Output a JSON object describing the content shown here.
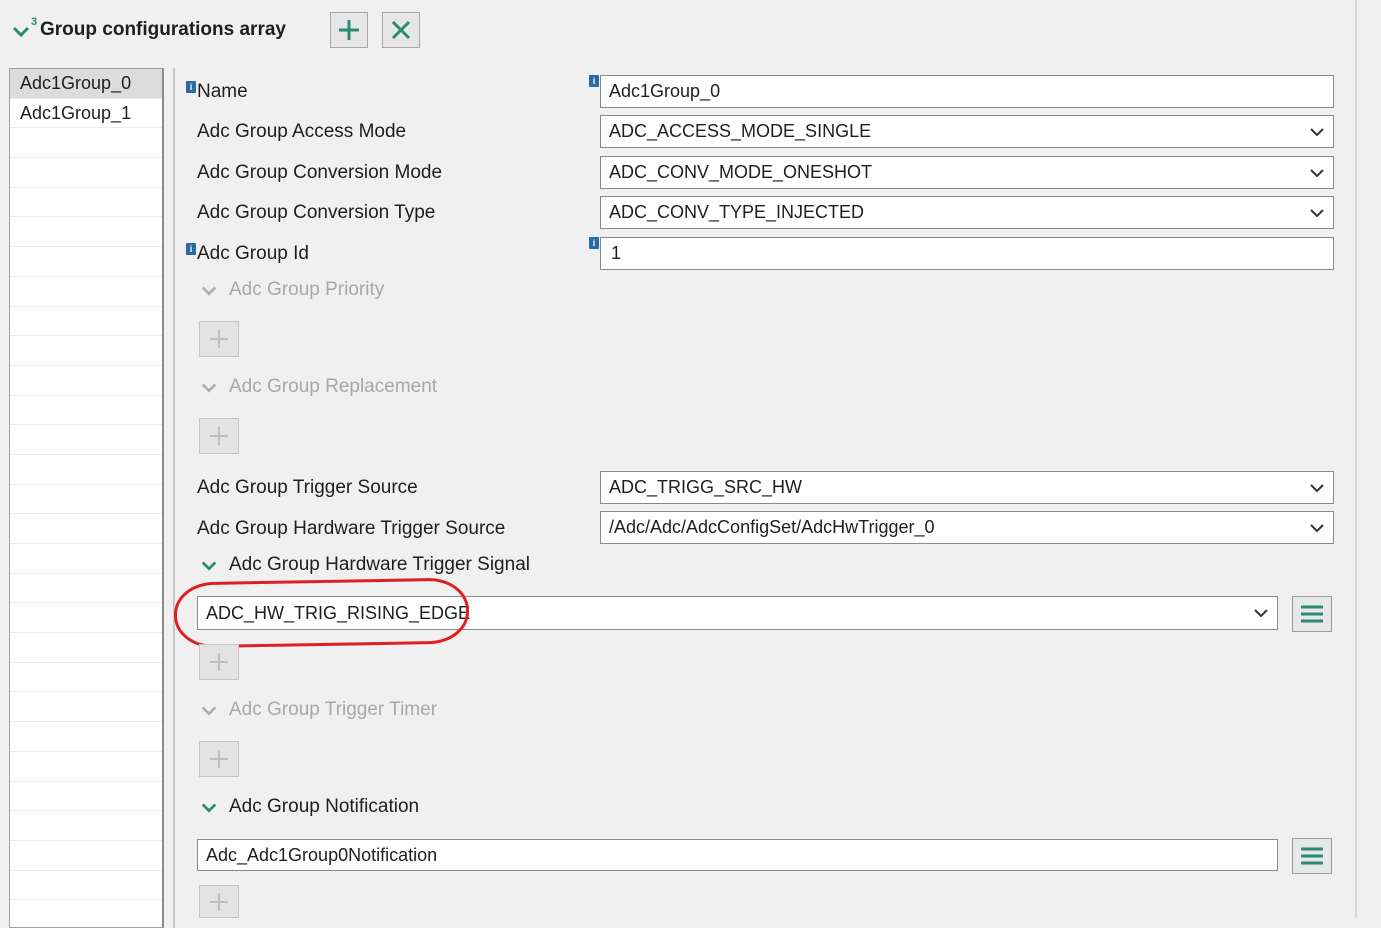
{
  "header": {
    "title": "Group configurations array",
    "badge": "3",
    "add_button_icon": "plus-icon",
    "remove_button_icon": "close-icon",
    "accent_color": "#2a8a72"
  },
  "list": {
    "items": [
      "Adc1Group_0",
      "Adc1Group_1"
    ],
    "selected_index": 0
  },
  "form": {
    "name": {
      "label": "Name",
      "value": "Adc1Group_0"
    },
    "access_mode": {
      "label": "Adc Group Access Mode",
      "value": "ADC_ACCESS_MODE_SINGLE"
    },
    "conversion_mode": {
      "label": "Adc Group Conversion Mode",
      "value": "ADC_CONV_MODE_ONESHOT"
    },
    "conversion_type": {
      "label": "Adc Group Conversion Type",
      "value": "ADC_CONV_TYPE_INJECTED"
    },
    "group_id": {
      "label": "Adc Group Id",
      "value": "1"
    },
    "priority": {
      "label": "Adc Group Priority"
    },
    "replacement": {
      "label": "Adc Group Replacement"
    },
    "trigger_source": {
      "label": "Adc Group Trigger Source",
      "value": "ADC_TRIGG_SRC_HW"
    },
    "hw_trigger_source": {
      "label": "Adc Group Hardware Trigger Source",
      "value": "/Adc/Adc/AdcConfigSet/AdcHwTrigger_0"
    },
    "hw_trigger_signal": {
      "label": "Adc Group Hardware Trigger Signal",
      "value": "ADC_HW_TRIG_RISING_EDGE"
    },
    "trigger_timer": {
      "label": "Adc Group Trigger Timer"
    },
    "notification": {
      "label": "Adc Group Notification",
      "value": "Adc_Adc1Group0Notification"
    }
  },
  "info_badge": "i",
  "annotation_color": "#e02020"
}
